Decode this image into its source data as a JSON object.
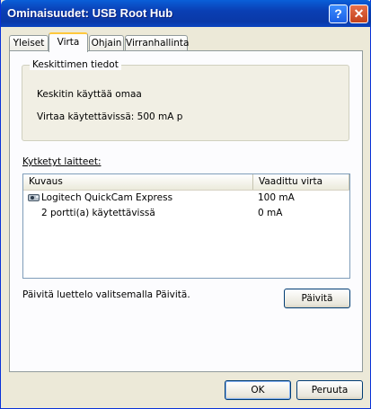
{
  "window": {
    "title": "Ominaisuudet: USB Root Hub"
  },
  "titlebar_buttons": {
    "help": "?",
    "close": "✕"
  },
  "tabs": [
    {
      "label": "Yleiset"
    },
    {
      "label": "Virta",
      "active": true
    },
    {
      "label": "Ohjain"
    },
    {
      "label": "Virranhallinta"
    }
  ],
  "hub_info": {
    "group_label": "Keskittimen tiedot",
    "line1": "Keskitin käyttää omaa",
    "line2": "Virtaa käytettävissä: 500 mA p"
  },
  "devices": {
    "label": "Kytketyt laitteet:",
    "columns": [
      "Kuvaus",
      "Vaadittu virta"
    ],
    "rows": [
      {
        "description": "Logitech QuickCam Express",
        "power": "100 mA",
        "icon": "usb-camera-icon"
      },
      {
        "description": "2 portti(a) käytettävissä",
        "power": "0 mA"
      }
    ]
  },
  "refresh": {
    "hint": "Päivitä luettelo valitsemalla Päivitä.",
    "button_label": "Päivitä"
  },
  "footer": {
    "ok_label": "OK",
    "cancel_label": "Peruuta"
  },
  "colors": {
    "titlebar": "#0a3fb4",
    "dialog_bg": "#ece9d8",
    "active_tab_accent": "#ffc83c"
  }
}
